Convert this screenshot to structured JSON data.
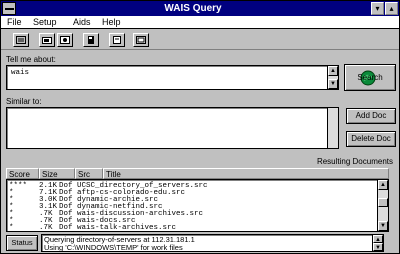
{
  "window": {
    "title": "WAIS Query",
    "min_glyph": "▾",
    "max_glyph": "▴"
  },
  "menu": [
    {
      "label": "File",
      "name": "menu-file"
    },
    {
      "label": "Setup",
      "name": "menu-setup"
    },
    {
      "label": "Aids",
      "name": "menu-aids"
    },
    {
      "label": "Help",
      "name": "menu-help"
    }
  ],
  "tell_me": {
    "label": "Tell me about:",
    "value": "wais"
  },
  "search_button": "Search",
  "similar": {
    "label": "Similar to:"
  },
  "add_doc_button": "Add Doc",
  "delete_doc_button": "Delete Doc",
  "results": {
    "title": "Resulting Documents",
    "columns": [
      "Score",
      "Size",
      "Src",
      "Title"
    ],
    "rows": [
      {
        "score": "****",
        "size": "2.1K",
        "src": "Dof",
        "title": "UCSC_directory_of_servers.src"
      },
      {
        "score": "*",
        "size": "7.1K",
        "src": "Dof",
        "title": "aftp-cs-colorado-edu.src"
      },
      {
        "score": "*",
        "size": "3.0K",
        "src": "Dof",
        "title": "dynamic-archie.src"
      },
      {
        "score": "*",
        "size": "3.1K",
        "src": "Dof",
        "title": "dynamic-netfind.src"
      },
      {
        "score": "*",
        "size": ".7K",
        "src": "Dof",
        "title": "wais-discussion-archives.src"
      },
      {
        "score": "*",
        "size": ".7K",
        "src": "Dof",
        "title": "wais-docs.src"
      },
      {
        "score": "*",
        "size": ".7K",
        "src": "Dof",
        "title": "wais-talk-archives.src"
      }
    ]
  },
  "status": {
    "label": "Status",
    "lines": [
      "Querying directory-of-servers at 112.31.181.1",
      "Using 'C:\\WINDOWS\\TEMP' for work files"
    ]
  },
  "colors": {
    "titlebar": "#000080",
    "face": "#c0c0c0"
  }
}
